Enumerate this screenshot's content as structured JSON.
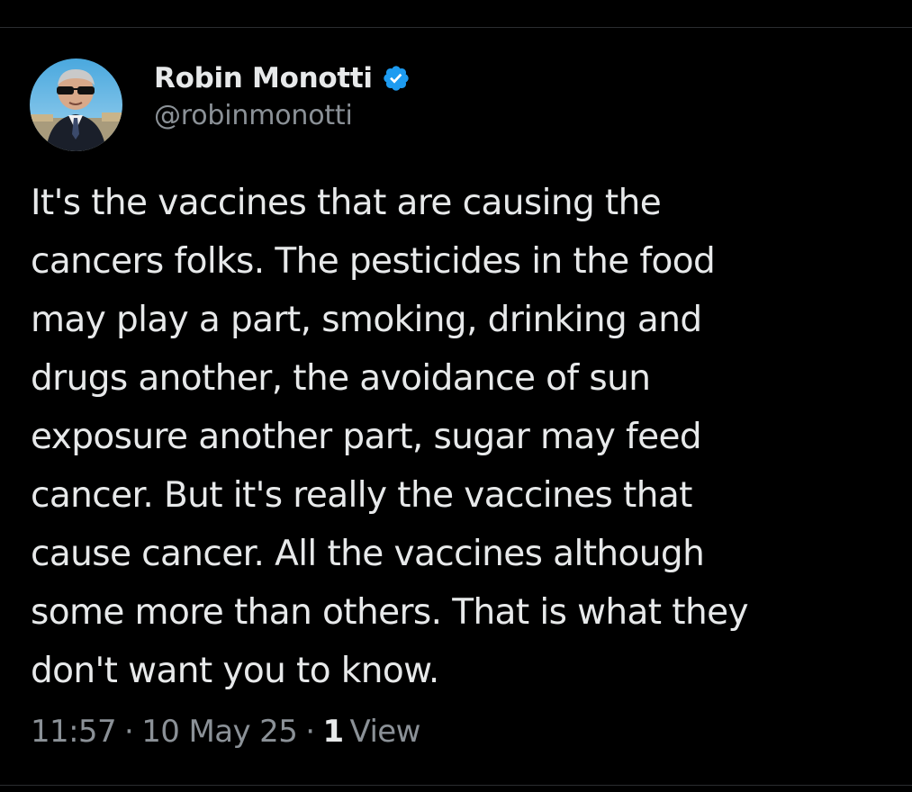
{
  "tweet": {
    "author": {
      "display_name": "Robin Monotti",
      "handle": "@robinmonotti",
      "verified_icon": "verified-badge-icon",
      "avatar_icon": "avatar"
    },
    "text": "It's the vaccines that are causing the\ncancers folks. The pesticides in the food\nmay play a part, smoking, drinking and\ndrugs another, the avoidance of sun\nexposure another part, sugar may feed\ncancer. But it's really the vaccines that\ncause cancer. All the vaccines although\nsome more than others. That is what they\ndon't want you to know.",
    "meta": {
      "time": "11:57",
      "separator": "·",
      "date": "10 May 25",
      "views_count": "1",
      "views_label": "View"
    }
  },
  "colors": {
    "background": "#000000",
    "primary_text": "#e7e9ea",
    "secondary_text": "#8b9197",
    "verified_blue": "#1d9bf0",
    "divider": "#2a2d30"
  }
}
